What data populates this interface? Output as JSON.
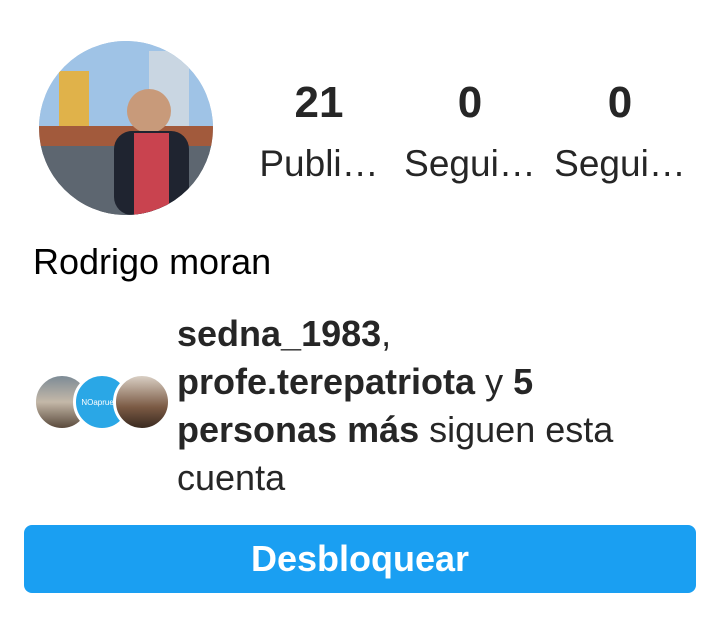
{
  "profile": {
    "name": "Rodrigo moran",
    "avatar_icon": "profile-photo"
  },
  "stats": [
    {
      "value": "21",
      "label": "Publi…"
    },
    {
      "value": "0",
      "label": "Segui…"
    },
    {
      "value": "0",
      "label": "Segui…"
    }
  ],
  "followed_by": {
    "user1": "sedna_1983",
    "sep1": ",",
    "user2": "profe.terepatriota",
    "connector": " y ",
    "others": "5 personas más",
    "suffix": " siguen esta cuenta",
    "avatar2_text": "NOaprueba"
  },
  "actions": {
    "unblock_label": "Desbloquear"
  },
  "colors": {
    "accent": "#1a9ff2",
    "text": "#262626"
  }
}
